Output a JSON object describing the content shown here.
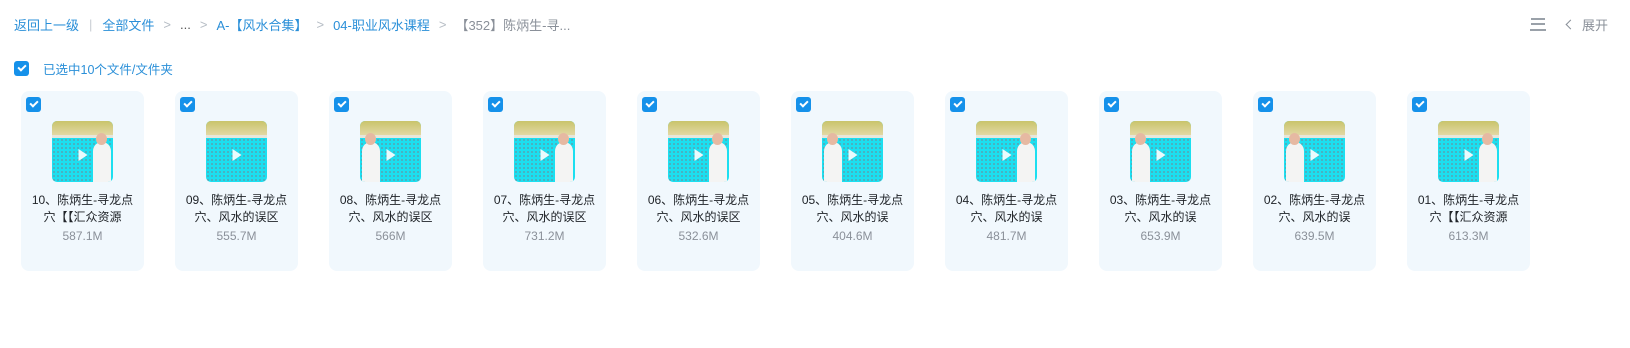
{
  "breadcrumb": {
    "back": "返回上一级",
    "all_files": "全部文件",
    "ellipsis": "...",
    "level1": "A-【风水合集】",
    "level2": "04-职业风水课程",
    "current": "【352】陈炳生-寻..."
  },
  "toolbar": {
    "expand_label": "展开"
  },
  "selection": {
    "text": "已选中10个文件/文件夹"
  },
  "files": [
    {
      "name": "10、陈炳生-寻龙点穴【【汇众资源",
      "size": "587.1M",
      "checked": true,
      "person_side": "right"
    },
    {
      "name": "09、陈炳生-寻龙点穴、风水的误区",
      "size": "555.7M",
      "checked": true,
      "person_side": "none"
    },
    {
      "name": "08、陈炳生-寻龙点穴、风水的误区",
      "size": "566M",
      "checked": true,
      "person_side": "left"
    },
    {
      "name": "07、陈炳生-寻龙点穴、风水的误区",
      "size": "731.2M",
      "checked": true,
      "person_side": "right"
    },
    {
      "name": "06、陈炳生-寻龙点穴、风水的误区",
      "size": "532.6M",
      "checked": true,
      "person_side": "right"
    },
    {
      "name": "05、陈炳生-寻龙点穴、风水的误",
      "size": "404.6M",
      "checked": true,
      "person_side": "left"
    },
    {
      "name": "04、陈炳生-寻龙点穴、风水的误",
      "size": "481.7M",
      "checked": true,
      "person_side": "right"
    },
    {
      "name": "03、陈炳生-寻龙点穴、风水的误",
      "size": "653.9M",
      "checked": true,
      "person_side": "left"
    },
    {
      "name": "02、陈炳生-寻龙点穴、风水的误",
      "size": "639.5M",
      "checked": true,
      "person_side": "left"
    },
    {
      "name": "01、陈炳生-寻龙点穴【【汇众资源",
      "size": "613.3M",
      "checked": true,
      "person_side": "right"
    }
  ]
}
